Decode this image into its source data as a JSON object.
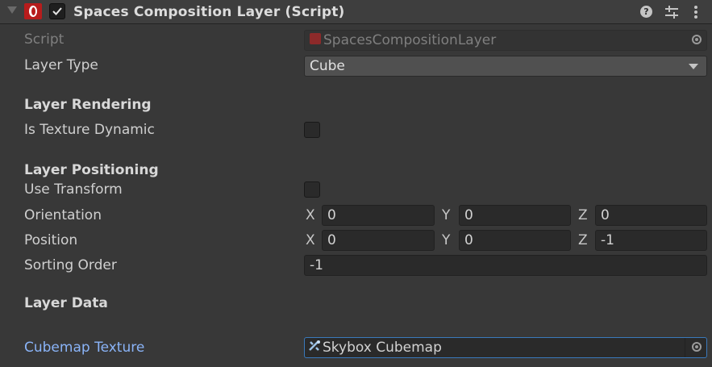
{
  "header": {
    "title": "Spaces Composition Layer (Script)",
    "enabled": true,
    "help_icon": "help-icon",
    "presets_icon": "presets-icon",
    "more_icon": "more-icon"
  },
  "fields": {
    "script": {
      "label": "Script",
      "value": "SpacesCompositionLayer"
    },
    "layer_type": {
      "label": "Layer Type",
      "value": "Cube"
    },
    "layer_rendering": {
      "label": "Layer Rendering"
    },
    "is_texture_dynamic": {
      "label": "Is Texture Dynamic",
      "checked": false
    },
    "layer_positioning": {
      "label": "Layer Positioning"
    },
    "use_transform": {
      "label": "Use Transform",
      "checked": false
    },
    "orientation": {
      "label": "Orientation",
      "x_label": "X",
      "x": "0",
      "y_label": "Y",
      "y": "0",
      "z_label": "Z",
      "z": "0"
    },
    "position": {
      "label": "Position",
      "x_label": "X",
      "x": "0",
      "y_label": "Y",
      "y": "0",
      "z_label": "Z",
      "z": "-1"
    },
    "sorting_order": {
      "label": "Sorting Order",
      "value": "-1"
    },
    "layer_data": {
      "label": "Layer Data"
    },
    "cubemap_texture": {
      "label": "Cubemap Texture",
      "value": "Skybox Cubemap"
    }
  },
  "colors": {
    "background": "#383838",
    "field": "#2a2a2a",
    "link_label": "#8ab4f8",
    "selection_border": "#3a79bb",
    "brand_red": "#b71c1c"
  }
}
